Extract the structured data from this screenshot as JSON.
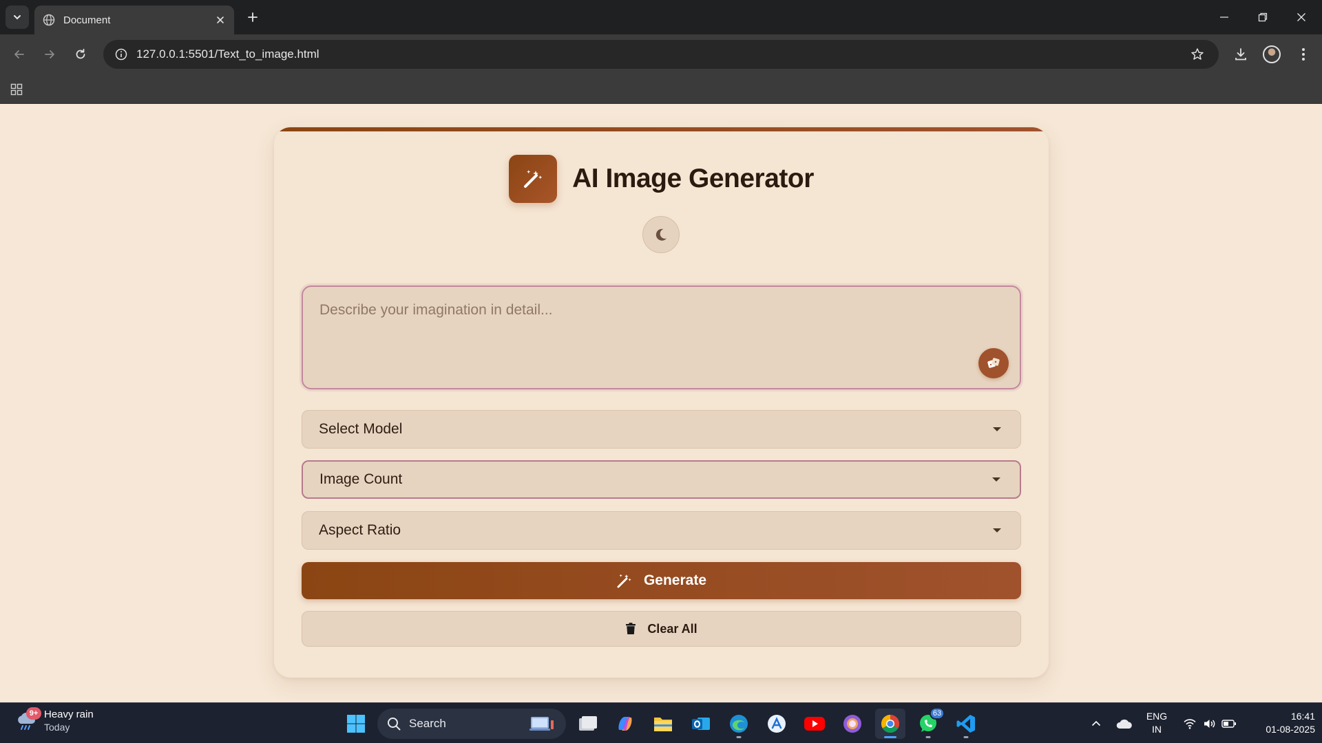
{
  "browser": {
    "tab_title": "Document",
    "url": "127.0.0.1:5501/Text_to_image.html"
  },
  "app": {
    "title": "AI Image Generator",
    "prompt_placeholder": "Describe your imagination in detail...",
    "prompt_value": "",
    "selects": {
      "model": "Select Model",
      "count": "Image Count",
      "ratio": "Aspect Ratio"
    },
    "generate_label": "Generate",
    "clear_label": "Clear All"
  },
  "taskbar": {
    "weather_title": "Heavy rain",
    "weather_sub": "Today",
    "weather_badge": "9+",
    "search_label": "Search",
    "whatsapp_badge": "63",
    "lang_top": "ENG",
    "lang_bottom": "IN",
    "time": "16:41",
    "date": "01-08-2025"
  },
  "colors": {
    "accent": "#8b4513",
    "accent_light": "#a0522d",
    "page_bg": "#f6e7d6",
    "card_bg": "#f5e5d3",
    "field_bg": "#e7d4c0"
  },
  "icons": {
    "logo": "magic-wand-icon",
    "theme_toggle": "moon-icon",
    "random_prompt": "dice-icon",
    "generate": "magic-wand-icon",
    "clear": "trash-icon"
  }
}
